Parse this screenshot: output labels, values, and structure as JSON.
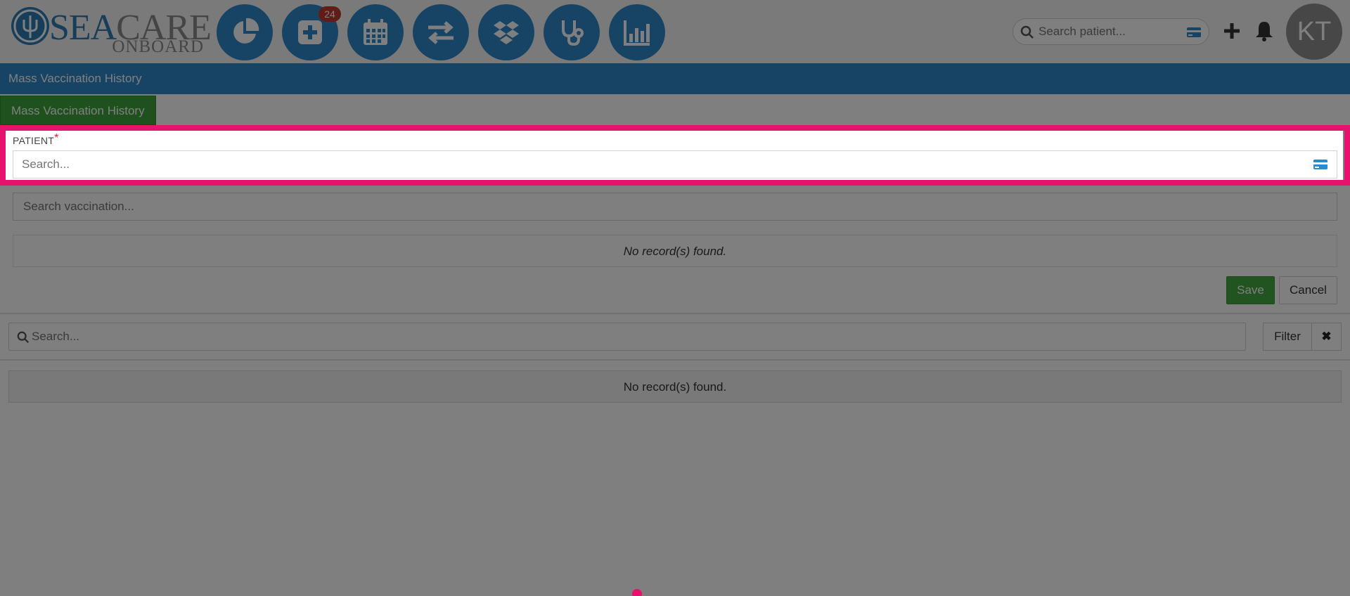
{
  "app": {
    "logo_primary": "SEA",
    "logo_secondary": "CARE",
    "logo_tagline": "ONBOARD"
  },
  "nav": [
    {
      "icon": "pie-chart-icon",
      "badge": ""
    },
    {
      "icon": "plus-square-icon",
      "badge": "24"
    },
    {
      "icon": "calendar-icon",
      "badge": ""
    },
    {
      "icon": "transfer-arrows-icon",
      "badge": ""
    },
    {
      "icon": "dropbox-icon",
      "badge": ""
    },
    {
      "icon": "stethoscope-icon",
      "badge": ""
    },
    {
      "icon": "bar-chart-icon",
      "badge": ""
    }
  ],
  "header": {
    "search_placeholder": "Search patient...",
    "avatar_initials": "KT"
  },
  "page": {
    "title": "Mass Vaccination History",
    "tab_active": "Mass Vaccination History"
  },
  "form": {
    "patient_label": "PATIENT",
    "required_mark": "*",
    "patient_placeholder": "Search...",
    "vaccination_placeholder": "Search vaccination...",
    "empty_text": "No record(s) found.",
    "save_label": "Save",
    "cancel_label": "Cancel"
  },
  "list": {
    "search_placeholder": "Search...",
    "filter_label": "Filter",
    "clear_label": "✖",
    "empty_text": "No record(s) found."
  },
  "colors": {
    "brand_blue": "#2e89c9",
    "save_green": "#45a845",
    "highlight": "#e8126c",
    "badge_red": "#c0392b"
  }
}
